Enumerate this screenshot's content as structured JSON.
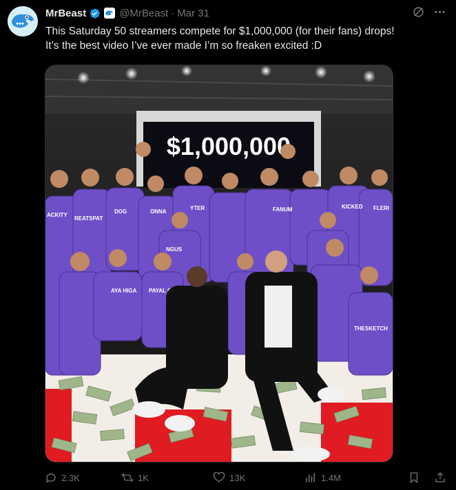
{
  "author": {
    "name": "MrBeast",
    "handle": "@MrBeast",
    "date": "Mar 31"
  },
  "tweet": {
    "text_line1": "This Saturday 50 streamers compete for $1,000,000 (for their fans) drops!",
    "text_line2": "It’s the best video I’ve ever made I’m so freaken excited :D"
  },
  "media": {
    "screen_text": "$1,000,000",
    "jacket_names": [
      "ACKITY",
      "REATSPAT",
      "DOG",
      "ONNA",
      "YTER",
      "FANUM",
      "KICKED",
      "FLERI",
      "NGUS",
      "AYA HIGA",
      "PAYAL GAMI",
      "THESKETCH"
    ]
  },
  "actions": {
    "replies": "2.3K",
    "reposts": "1K",
    "likes": "13K",
    "views": "1.4M"
  },
  "colors": {
    "background": "#000000",
    "text": "#e7e9ea",
    "muted": "#71767b",
    "verified": "#1d9bf0",
    "jacket_purple": "#6f4fc8",
    "floor_red": "#e01b22"
  }
}
